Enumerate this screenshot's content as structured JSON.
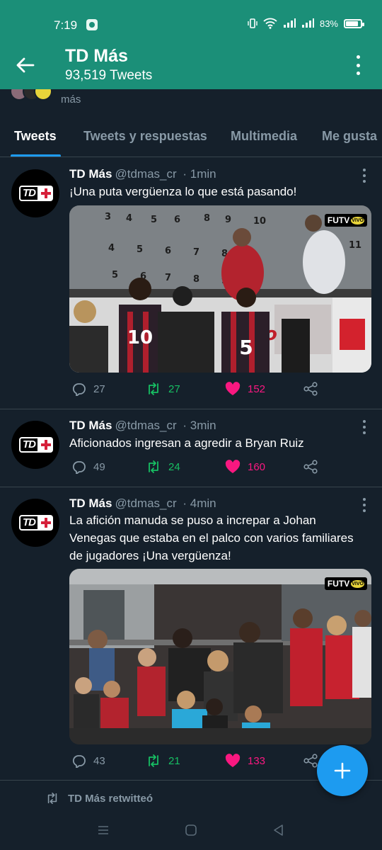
{
  "status_bar": {
    "time": "7:19",
    "battery": "83%",
    "icons": [
      "notification-icon",
      "vibrate-icon",
      "wifi-icon",
      "signal-icon",
      "signal-icon",
      "battery-icon"
    ]
  },
  "header": {
    "title": "TD Más",
    "subtitle": "93,519 Tweets",
    "back_icon": "arrow-left-icon",
    "menu_icon": "more-vertical-icon"
  },
  "bio_peek": {
    "text": "más"
  },
  "tabs": [
    {
      "label": "Tweets",
      "active": true
    },
    {
      "label": "Tweets y respuestas",
      "active": false
    },
    {
      "label": "Multimedia",
      "active": false
    },
    {
      "label": "Me gusta",
      "active": false
    }
  ],
  "tweets": [
    {
      "name": "TD Más",
      "handle": "@tdmas_cr",
      "time": "1min",
      "text": "¡Una puta vergüenza lo que está pasando!",
      "media": {
        "badge": "FUTV",
        "badge_sub": "VIVO",
        "numbers": [
          "10",
          "5"
        ]
      },
      "replies": "27",
      "retweets": "27",
      "likes": "152"
    },
    {
      "name": "TD Más",
      "handle": "@tdmas_cr",
      "time": "3min",
      "text": "Aficionados ingresan a agredir a Bryan Ruiz",
      "replies": "49",
      "retweets": "24",
      "likes": "160"
    },
    {
      "name": "TD Más",
      "handle": "@tdmas_cr",
      "time": "4min",
      "text_lines": [
        "La afición manuda se puso a increpar a Johan",
        "Venegas que estaba en el palco con varios familiares",
        "de jugadores ¡Una vergüenza!"
      ],
      "media": {
        "badge": "FUTV",
        "badge_sub": "VIVO"
      },
      "replies": "43",
      "retweets": "21",
      "likes": "133"
    }
  ],
  "retweeted_label": "TD Más retwitteó",
  "fab_icon": "plus-icon",
  "colors": {
    "header_bg": "#1b8f78",
    "background": "#15202b",
    "accent": "#1d9bf0",
    "retweet": "#17bf63",
    "like": "#f91880",
    "muted": "#8899a6"
  }
}
